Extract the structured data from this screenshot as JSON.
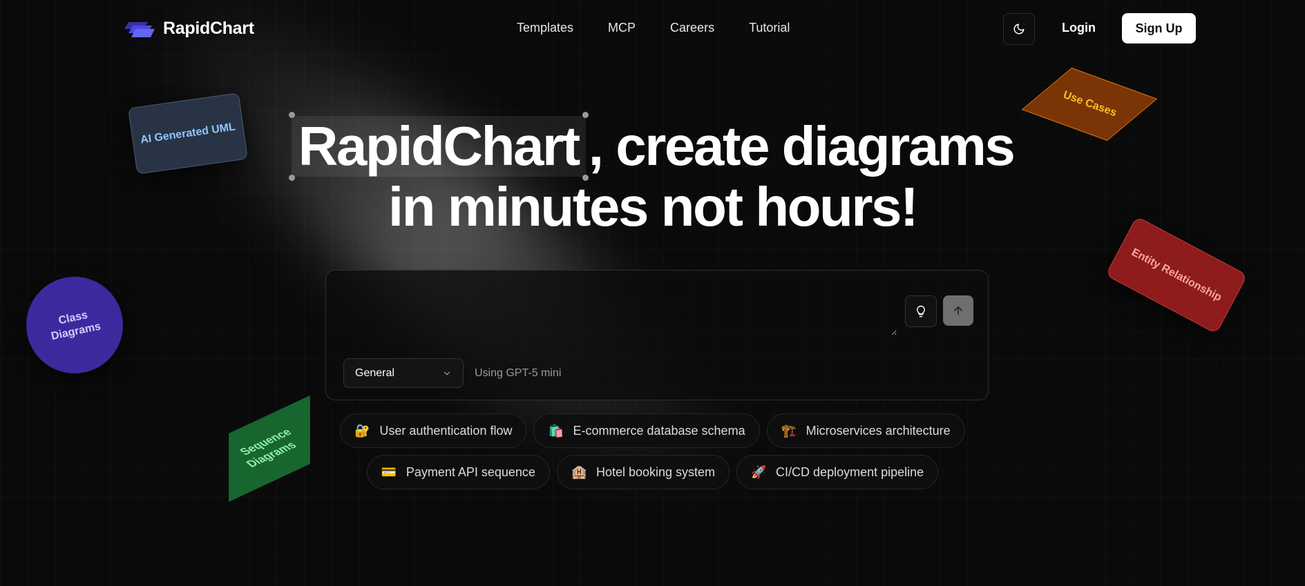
{
  "brand": {
    "name": "RapidChart"
  },
  "nav": {
    "links": [
      "Templates",
      "MCP",
      "Careers",
      "Tutorial"
    ],
    "login": "Login",
    "signup": "Sign Up"
  },
  "hero": {
    "highlight": "RapidChart",
    "line1_rest": ", create diagrams",
    "line2": "in minutes not hours!"
  },
  "prompt": {
    "value": "",
    "placeholder": "",
    "select_value": "General",
    "model_label": "Using GPT-5 mini"
  },
  "suggestions": [
    {
      "emoji": "🔐",
      "label": "User authentication flow"
    },
    {
      "emoji": "🛍️",
      "label": "E-commerce database schema"
    },
    {
      "emoji": "🏗️",
      "label": "Microservices architecture"
    },
    {
      "emoji": "💳",
      "label": "Payment API sequence"
    },
    {
      "emoji": "🏨",
      "label": "Hotel booking system"
    },
    {
      "emoji": "🚀",
      "label": "CI/CD deployment pipeline"
    }
  ],
  "floating_cards": {
    "uml": "AI Generated UML",
    "class_line1": "Class",
    "class_line2": "Diagrams",
    "sequence_line1": "Sequence",
    "sequence_line2": "Diagrams",
    "use_cases": "Use Cases",
    "entity": "Entity Relationship"
  },
  "icons": {
    "logo": "stacked-layers-icon",
    "theme": "moon-icon",
    "idea": "lightbulb-icon",
    "send": "arrow-up-icon",
    "select": "chevron-down-icon"
  },
  "colors": {
    "background": "#0a0a0a",
    "accent_logo": "#6366f1",
    "signup_bg": "#ffffff"
  }
}
